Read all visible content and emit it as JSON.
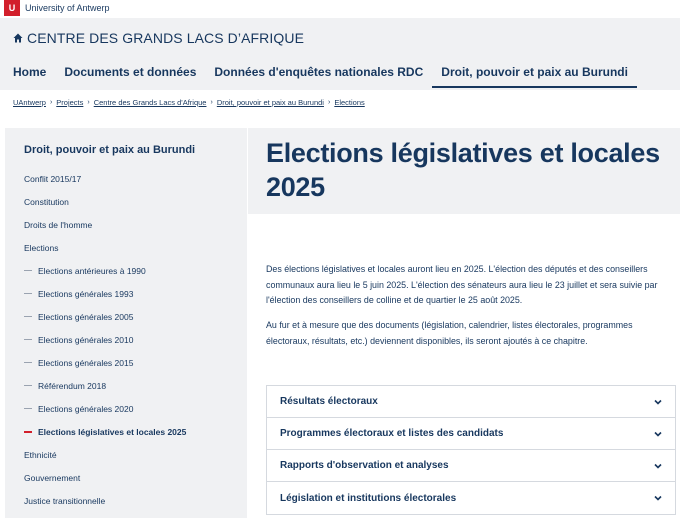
{
  "university": {
    "logo_glyph": "U",
    "name": "University of Antwerp",
    "brand_color": "#d21f2b"
  },
  "site": {
    "title": "CENTRE DES GRANDS LACS D’AFRIQUE",
    "home_icon": "home-icon",
    "nav": [
      {
        "label": "Home",
        "active": false
      },
      {
        "label": "Documents et données",
        "active": false
      },
      {
        "label": "Données d'enquêtes nationales RDC",
        "active": false
      },
      {
        "label": "Droit, pouvoir et paix au Burundi",
        "active": true
      }
    ]
  },
  "breadcrumb": [
    "UAntwerp",
    "Projects",
    "Centre des Grands Lacs d'Afrique",
    "Droit, pouvoir et paix au Burundi",
    "Elections"
  ],
  "sidebar": {
    "title": "Droit, pouvoir et paix au Burundi",
    "items": [
      {
        "label": "Conflit 2015/17",
        "level": 1
      },
      {
        "label": "Constitution",
        "level": 1
      },
      {
        "label": "Droits de l'homme",
        "level": 1
      },
      {
        "label": "Elections",
        "level": 1
      },
      {
        "label": "Elections antérieures à 1990",
        "level": 2
      },
      {
        "label": "Elections générales 1993",
        "level": 2
      },
      {
        "label": "Elections générales 2005",
        "level": 2
      },
      {
        "label": "Elections générales 2010",
        "level": 2
      },
      {
        "label": "Elections générales 2015",
        "level": 2
      },
      {
        "label": "Référendum 2018",
        "level": 2
      },
      {
        "label": "Elections générales 2020",
        "level": 2
      },
      {
        "label": "Elections législatives et locales 2025",
        "level": 2,
        "current": true
      },
      {
        "label": "Ethnicité",
        "level": 1
      },
      {
        "label": "Gouvernement",
        "level": 1
      },
      {
        "label": "Justice transitionnelle",
        "level": 1
      }
    ]
  },
  "main": {
    "title": "Elections législatives et locales 2025",
    "paragraphs": [
      "Des élections législatives et locales auront lieu en 2025. L'élection des députés et des conseillers communaux aura lieu le 5 juin 2025. L'élection des sénateurs aura lieu le 23 juillet et sera suivie par l'élection des conseillers de colline et de quartier le 25 août 2025.",
      "Au fur et à mesure que des documents (législation, calendrier, listes électorales, programmes électoraux, résultats, etc.) deviennent disponibles, ils seront ajoutés à ce chapitre."
    ],
    "accordion": [
      {
        "label": "Résultats électoraux",
        "icon": "chevron-down-icon"
      },
      {
        "label": "Programmes électoraux et listes des candidats",
        "icon": "chevron-down-icon"
      },
      {
        "label": "Rapports d'observation et analyses",
        "icon": "chevron-down-icon"
      },
      {
        "label": "Législation et institutions électorales",
        "icon": "chevron-down-icon"
      }
    ]
  }
}
